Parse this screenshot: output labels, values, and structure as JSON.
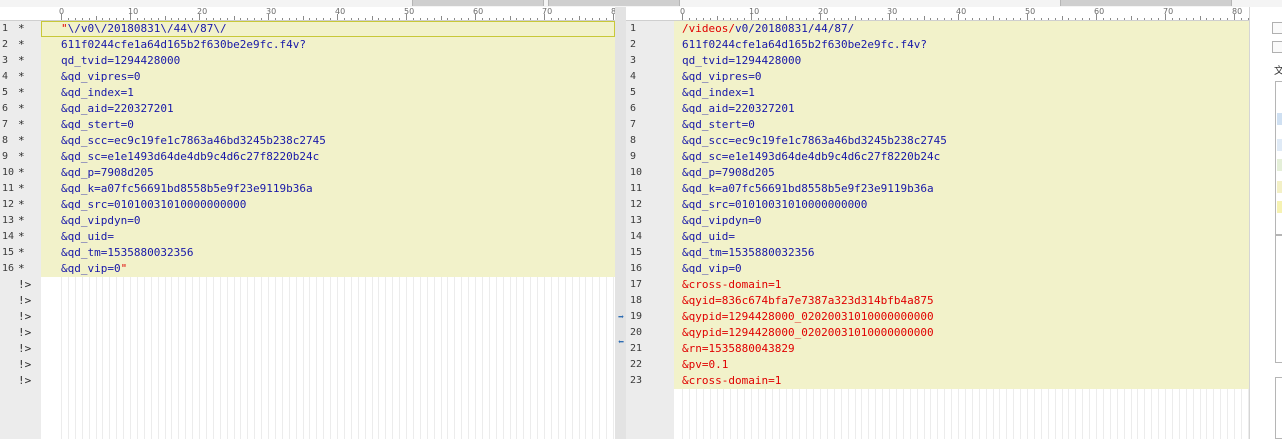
{
  "colors": {
    "text_blue": "#1818a8",
    "text_red": "#e00000",
    "highlight": "#f2f2ca",
    "gutter": "#ececec",
    "ruler_text": "#6a6a6a"
  },
  "ruler": {
    "ticks": [
      "0",
      "10",
      "20",
      "30",
      "40",
      "50",
      "60",
      "70",
      "80"
    ]
  },
  "left_pane": {
    "lines": [
      {
        "ln": "1",
        "mark": "*",
        "segs": [
          {
            "t": "\"",
            "c": "red"
          },
          {
            "t": "\\/v0\\/20180831\\/44\\/87\\/",
            "c": "blue"
          }
        ]
      },
      {
        "ln": "2",
        "mark": "*",
        "segs": [
          {
            "t": "611f0244cfe1a64d165b2f630be2e9fc.f4v?",
            "c": "blue"
          }
        ]
      },
      {
        "ln": "3",
        "mark": "*",
        "segs": [
          {
            "t": "qd_tvid=1294428000",
            "c": "blue"
          }
        ]
      },
      {
        "ln": "4",
        "mark": "*",
        "segs": [
          {
            "t": "&qd_vipres=0",
            "c": "blue"
          }
        ]
      },
      {
        "ln": "5",
        "mark": "*",
        "segs": [
          {
            "t": "&qd_index=1",
            "c": "blue"
          }
        ]
      },
      {
        "ln": "6",
        "mark": "*",
        "segs": [
          {
            "t": "&qd_aid=220327201",
            "c": "blue"
          }
        ]
      },
      {
        "ln": "7",
        "mark": "*",
        "segs": [
          {
            "t": "&qd_stert=0",
            "c": "blue"
          }
        ]
      },
      {
        "ln": "8",
        "mark": "*",
        "segs": [
          {
            "t": "&qd_scc=ec9c19fe1c7863a46bd3245b238c2745",
            "c": "blue"
          }
        ]
      },
      {
        "ln": "9",
        "mark": "*",
        "segs": [
          {
            "t": "&qd_sc=e1e1493d64de4db9c4d6c27f8220b24c",
            "c": "blue"
          }
        ]
      },
      {
        "ln": "10",
        "mark": "*",
        "segs": [
          {
            "t": "&qd_p=7908d205",
            "c": "blue"
          }
        ]
      },
      {
        "ln": "11",
        "mark": "*",
        "segs": [
          {
            "t": "&qd_k=a07fc56691bd8558b5e9f23e9119b36a",
            "c": "blue"
          }
        ]
      },
      {
        "ln": "12",
        "mark": "*",
        "segs": [
          {
            "t": "&qd_src=01010031010000000000",
            "c": "blue"
          }
        ]
      },
      {
        "ln": "13",
        "mark": "*",
        "segs": [
          {
            "t": "&qd_vipdyn=0",
            "c": "blue"
          }
        ]
      },
      {
        "ln": "14",
        "mark": "*",
        "segs": [
          {
            "t": "&qd_uid=",
            "c": "blue"
          }
        ]
      },
      {
        "ln": "15",
        "mark": "*",
        "segs": [
          {
            "t": "&qd_tm=1535880032356",
            "c": "blue"
          }
        ]
      },
      {
        "ln": "16",
        "mark": "*",
        "segs": [
          {
            "t": "&qd_vip=0",
            "c": "blue"
          },
          {
            "t": "\"",
            "c": "red"
          }
        ]
      },
      {
        "ln": "",
        "mark": "!>",
        "segs": []
      },
      {
        "ln": "",
        "mark": "!>",
        "segs": []
      },
      {
        "ln": "",
        "mark": "!>",
        "segs": []
      },
      {
        "ln": "",
        "mark": "!>",
        "segs": []
      },
      {
        "ln": "",
        "mark": "!>",
        "segs": []
      },
      {
        "ln": "",
        "mark": "!>",
        "segs": []
      },
      {
        "ln": "",
        "mark": "!>",
        "segs": []
      }
    ]
  },
  "right_pane": {
    "lines": [
      {
        "ln": "1",
        "segs": [
          {
            "t": "/videos/",
            "c": "red"
          },
          {
            "t": "v0/20180831/44/87/",
            "c": "blue"
          }
        ]
      },
      {
        "ln": "2",
        "segs": [
          {
            "t": "611f0244cfe1a64d165b2f630be2e9fc.f4v?",
            "c": "blue"
          }
        ]
      },
      {
        "ln": "3",
        "segs": [
          {
            "t": "qd_tvid=1294428000",
            "c": "blue"
          }
        ]
      },
      {
        "ln": "4",
        "segs": [
          {
            "t": "&qd_vipres=0",
            "c": "blue"
          }
        ]
      },
      {
        "ln": "5",
        "segs": [
          {
            "t": "&qd_index=1",
            "c": "blue"
          }
        ]
      },
      {
        "ln": "6",
        "segs": [
          {
            "t": "&qd_aid=220327201",
            "c": "blue"
          }
        ]
      },
      {
        "ln": "7",
        "segs": [
          {
            "t": "&qd_stert=0",
            "c": "blue"
          }
        ]
      },
      {
        "ln": "8",
        "segs": [
          {
            "t": "&qd_scc=ec9c19fe1c7863a46bd3245b238c2745",
            "c": "blue"
          }
        ]
      },
      {
        "ln": "9",
        "segs": [
          {
            "t": "&qd_sc=e1e1493d64de4db9c4d6c27f8220b24c",
            "c": "blue"
          }
        ]
      },
      {
        "ln": "10",
        "segs": [
          {
            "t": "&qd_p=7908d205",
            "c": "blue"
          }
        ]
      },
      {
        "ln": "11",
        "segs": [
          {
            "t": "&qd_k=a07fc56691bd8558b5e9f23e9119b36a",
            "c": "blue"
          }
        ]
      },
      {
        "ln": "12",
        "segs": [
          {
            "t": "&qd_src=01010031010000000000",
            "c": "blue"
          }
        ]
      },
      {
        "ln": "13",
        "segs": [
          {
            "t": "&qd_vipdyn=0",
            "c": "blue"
          }
        ]
      },
      {
        "ln": "14",
        "segs": [
          {
            "t": "&qd_uid=",
            "c": "blue"
          }
        ]
      },
      {
        "ln": "15",
        "segs": [
          {
            "t": "&qd_tm=1535880032356",
            "c": "blue"
          }
        ]
      },
      {
        "ln": "16",
        "segs": [
          {
            "t": "&qd_vip=0",
            "c": "blue"
          }
        ]
      },
      {
        "ln": "17",
        "segs": [
          {
            "t": "&cross-domain=1",
            "c": "red"
          }
        ]
      },
      {
        "ln": "18",
        "segs": [
          {
            "t": "&qyid=836c674bfa7e7387a323d314bfb4a875",
            "c": "red"
          }
        ]
      },
      {
        "ln": "19",
        "segs": [
          {
            "t": "&qypid=1294428000_02020031010000000000",
            "c": "red"
          }
        ]
      },
      {
        "ln": "20",
        "segs": [
          {
            "t": "&qypid=1294428000_02020031010000000000",
            "c": "red"
          }
        ]
      },
      {
        "ln": "21",
        "segs": [
          {
            "t": "&rn=1535880043829",
            "c": "red"
          }
        ]
      },
      {
        "ln": "22",
        "segs": [
          {
            "t": "&pv=0.1",
            "c": "red"
          }
        ]
      },
      {
        "ln": "23",
        "segs": [
          {
            "t": "&cross-domain=1",
            "c": "red"
          }
        ]
      }
    ]
  },
  "splitter": {
    "copy_right_icon": "arrow-right-icon",
    "copy_left_icon": "arrow-left-icon"
  },
  "right_strip": {
    "char": "文"
  }
}
